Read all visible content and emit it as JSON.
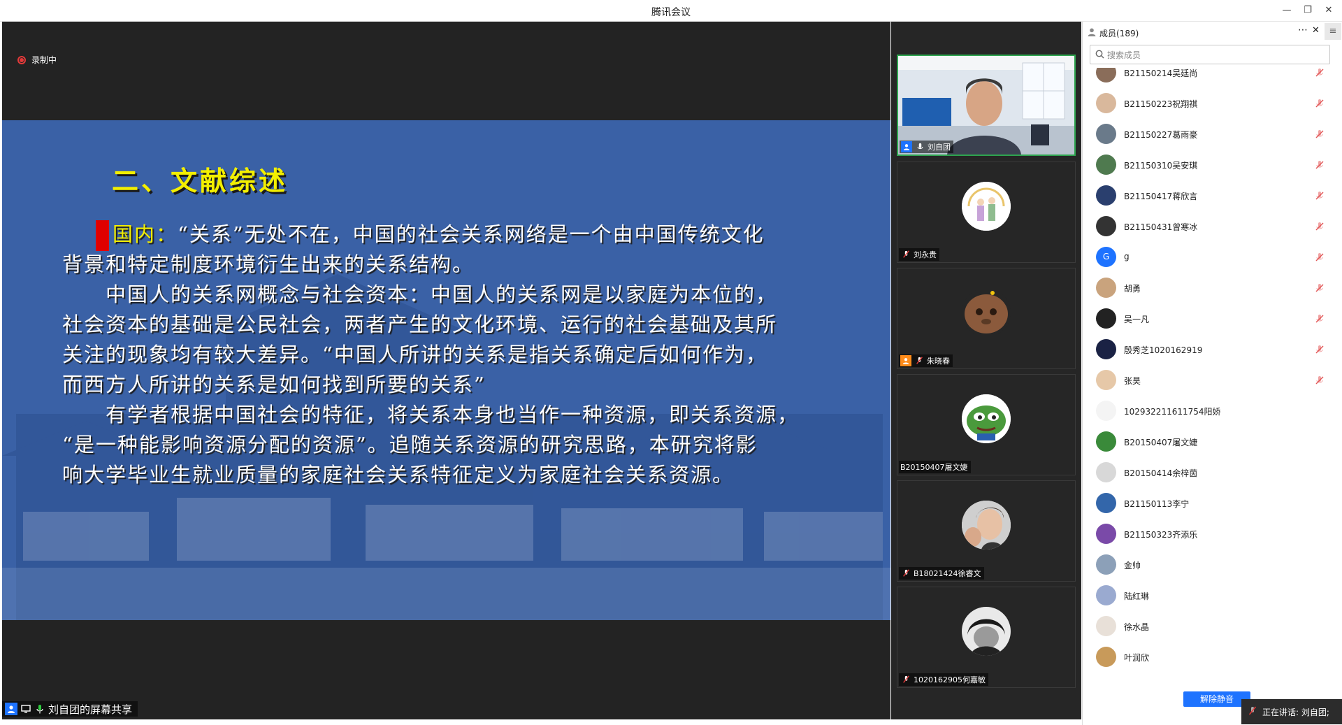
{
  "window": {
    "title": "腾讯会议"
  },
  "recording": {
    "label": "录制中"
  },
  "slide": {
    "title": "二、文献综述",
    "para1_lead": "国内：",
    "para1_line1_rest": "“关系”无处不在，中国的社会关系网络是一个由中国传统文化",
    "para1_line2": "背景和特定制度环境衍生出来的关系结构。",
    "para2_lines": [
      "　　中国人的关系网概念与社会资本：中国人的关系网是以家庭为本位的，",
      "社会资本的基础是公民社会，两者产生的文化环境、运行的社会基础及其所",
      "关注的现象均有较大差异。“中国人所讲的关系是指关系确定后如何作为，",
      "而西方人所讲的关系是如何找到所要的关系”"
    ],
    "para3_lines": [
      "　　有学者根据中国社会的特征，将关系本身也当作一种资源，即关系资源，",
      "“是一种能影响资源分配的资源”。追随关系资源的研究思路，本研究将影",
      "响大学毕业生就业质量的家庭社会关系特征定义为家庭社会关系资源。"
    ]
  },
  "share_bar": {
    "label": "刘自团的屏幕共享"
  },
  "video_tiles": [
    {
      "name": "刘自团"
    },
    {
      "name": "刘永贵"
    },
    {
      "name": "朱晓春"
    },
    {
      "name": "B20150407屠文婕"
    },
    {
      "name": "B18021424徐睿文"
    },
    {
      "name": "1020162905何嘉敏"
    }
  ],
  "panel": {
    "header": "成员(189)",
    "search_placeholder": "搜索成员",
    "unmute_all": "解除静音",
    "speaking": "正在讲话: 刘自团;"
  },
  "members": [
    {
      "name": "B21150214吴廷尚",
      "avatar_color": "#8a6d5a",
      "muted": true
    },
    {
      "name": "B21150223祝翔祺",
      "avatar_color": "#d9b89c",
      "muted": true
    },
    {
      "name": "B21150227葛雨豪",
      "avatar_color": "#6a7a8a",
      "muted": true
    },
    {
      "name": "B21150310吴安琪",
      "avatar_color": "#4f7a4f",
      "muted": true
    },
    {
      "name": "B21150417蒋欣言",
      "avatar_color": "#2a3f6e",
      "muted": true
    },
    {
      "name": "B21150431曾寒冰",
      "avatar_color": "#333333",
      "muted": true
    },
    {
      "name": "g",
      "avatar_color": "#1e73ff",
      "avatar_letter": "G",
      "muted": true
    },
    {
      "name": "胡勇",
      "avatar_color": "#c9a37d",
      "muted": true
    },
    {
      "name": "吴一凡",
      "avatar_color": "#222222",
      "muted": true
    },
    {
      "name": "殷秀芝1020162919",
      "avatar_color": "#1a2244",
      "muted": true
    },
    {
      "name": "张昊",
      "avatar_color": "#e6c8a8",
      "muted": true
    },
    {
      "name": "102932211611754阳娇",
      "avatar_color": "#f4f4f4",
      "muted": false
    },
    {
      "name": "B20150407屠文婕",
      "avatar_color": "#3a8a3a",
      "muted": false
    },
    {
      "name": "B20150414余梓茵",
      "avatar_color": "#d8d8d8",
      "muted": false
    },
    {
      "name": "B21150113李宁",
      "avatar_color": "#3366aa",
      "muted": false
    },
    {
      "name": "B21150323齐添乐",
      "avatar_color": "#7a4aa8",
      "muted": false
    },
    {
      "name": "金帅",
      "avatar_color": "#8ca0b8",
      "muted": false
    },
    {
      "name": "陆红琳",
      "avatar_color": "#9aaad0",
      "muted": false
    },
    {
      "name": "徐水晶",
      "avatar_color": "#e8e0d8",
      "muted": false
    },
    {
      "name": "叶润欣",
      "avatar_color": "#c89a5a",
      "muted": false
    }
  ],
  "colors": {
    "accent": "#1e73ff",
    "slide_bg": "#3a61a6",
    "title_yellow": "#f3ef00",
    "active_border": "#2ea44f"
  }
}
